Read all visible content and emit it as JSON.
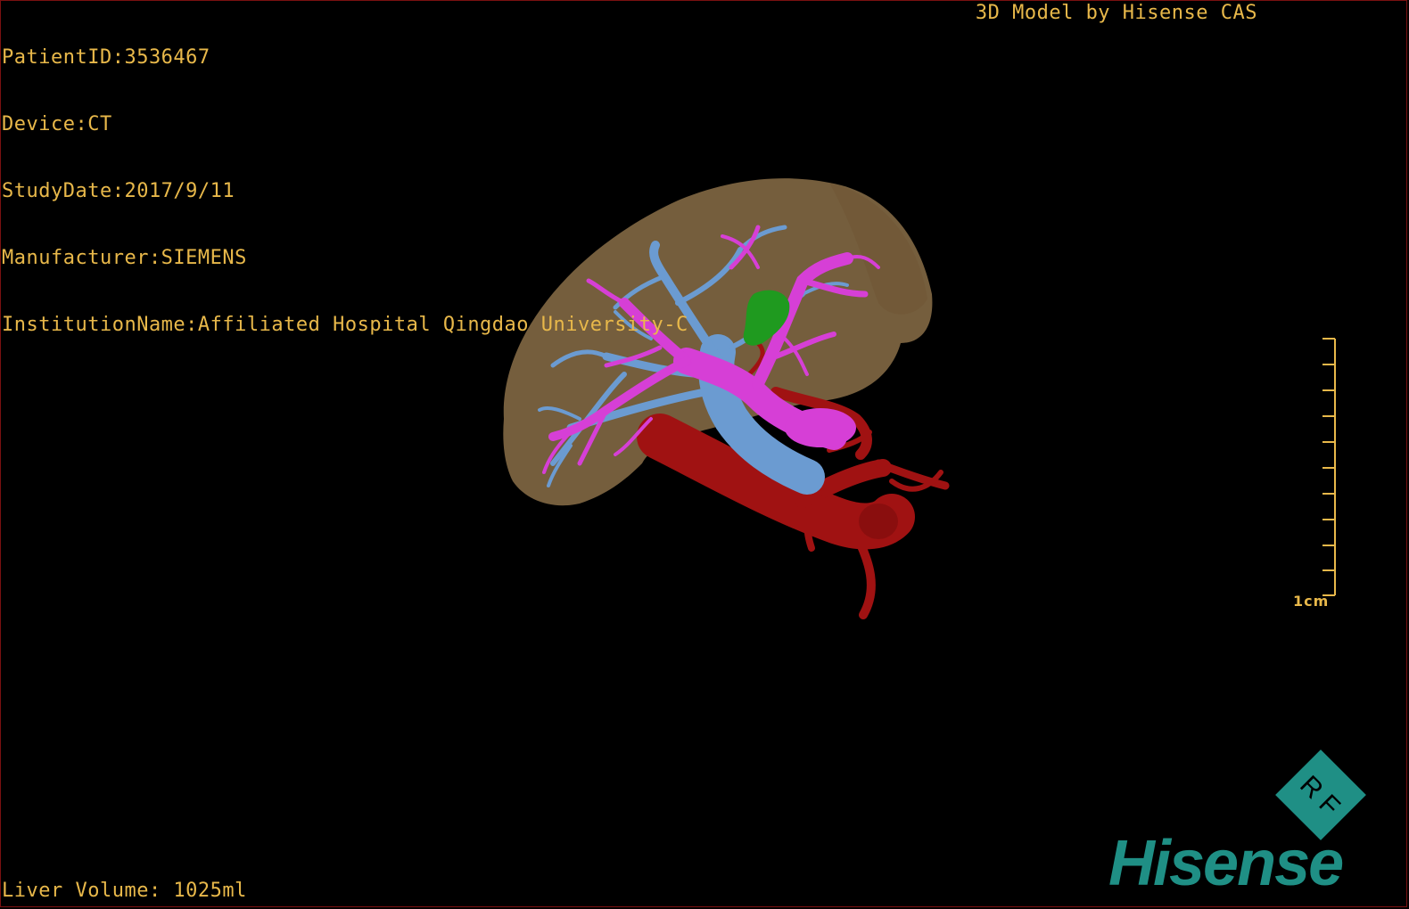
{
  "patient_info": {
    "lines": [
      "PatientID:3536467",
      "Device:CT",
      "StudyDate:2017/9/11",
      "Manufacturer:SIEMENS",
      "InstitutionName:Affiliated Hospital Qingdao University-C"
    ]
  },
  "vendor_caption": "3D Model by Hisense CAS",
  "liver_volume": "Liver Volume: 1025ml",
  "scale_bar": {
    "label": "1cm",
    "color": "#e8b84a"
  },
  "logo": {
    "badge_text": "R F",
    "wordmark": "Hisense",
    "color": "#1f8f85"
  },
  "model_colors": {
    "liver": "#8a6e48",
    "portal_vein": "#d63fd6",
    "hepatic_vein": "#6b9bd1",
    "artery_aorta": "#a01212",
    "gallbladder": "#1f9a1f"
  }
}
